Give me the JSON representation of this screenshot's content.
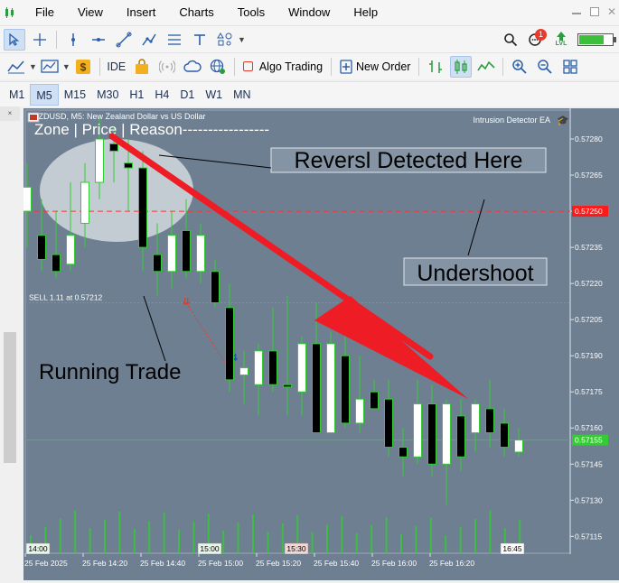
{
  "menu": {
    "items": [
      "File",
      "View",
      "Insert",
      "Charts",
      "Tools",
      "Window",
      "Help"
    ]
  },
  "toolbar2": {
    "ide_label": "IDE",
    "algo_label": "Algo Trading",
    "order_label": "New Order"
  },
  "toolbar1": {
    "notification_count": "1",
    "lvl_label": "LVL"
  },
  "timeframes": [
    "M1",
    "M5",
    "M15",
    "M30",
    "H1",
    "H4",
    "D1",
    "W1",
    "MN"
  ],
  "active_timeframe": "M5",
  "chart": {
    "symbol_title": "NZDUSD, M5:  New Zealand Dollar vs US Dollar",
    "ea_name": "Intrusion Detector EA",
    "header_text": "Zone            |  Price      |  Reason-----------------",
    "annotation_reversal": "Reversl Detected Here",
    "annotation_undershoot": "Undershoot",
    "annotation_running": "Running Trade",
    "trade_label": "SELL 1.11 at 0.57212",
    "red_level_label": "0.57250",
    "current_price_label": "0.57155",
    "colors": {
      "background": "#6d7f91",
      "bull": "#ffffff",
      "bear": "#000000",
      "wick": "#33cc33",
      "arrow": "#ee1c24",
      "red_level": "#ff3333"
    }
  },
  "chart_data": {
    "type": "candlestick",
    "y_ticks": [
      "0.57280",
      "0.57265",
      "0.57250",
      "0.57235",
      "0.57220",
      "0.57205",
      "0.57190",
      "0.57175",
      "0.57160",
      "0.57145",
      "0.57130",
      "0.57115"
    ],
    "ylim": [
      0.57108,
      0.57292
    ],
    "time_labels": [
      "25 Feb 2025",
      "25 Feb 14:20",
      "25 Feb 14:40",
      "25 Feb 15:00",
      "25 Feb 15:20",
      "25 Feb 15:40",
      "25 Feb 16:00",
      "25 Feb 16:20"
    ],
    "session_markers": [
      "14:00",
      "15:00",
      "15:30",
      "16:45"
    ],
    "candles": [
      [
        0.5725,
        0.5727,
        0.57235,
        0.5726
      ],
      [
        0.5724,
        0.57255,
        0.57225,
        0.5723
      ],
      [
        0.57232,
        0.5725,
        0.57222,
        0.57225
      ],
      [
        0.57228,
        0.57262,
        0.57225,
        0.5724
      ],
      [
        0.57245,
        0.5727,
        0.57235,
        0.57262
      ],
      [
        0.57262,
        0.5729,
        0.57255,
        0.5728
      ],
      [
        0.57278,
        0.57285,
        0.57262,
        0.57275
      ],
      [
        0.5727,
        0.5728,
        0.5725,
        0.57268
      ],
      [
        0.57268,
        0.57275,
        0.57225,
        0.57235
      ],
      [
        0.57232,
        0.57245,
        0.57215,
        0.57225
      ],
      [
        0.57225,
        0.5725,
        0.57218,
        0.5724
      ],
      [
        0.57242,
        0.57255,
        0.57222,
        0.57225
      ],
      [
        0.57225,
        0.57245,
        0.5722,
        0.5724
      ],
      [
        0.57225,
        0.5723,
        0.5721,
        0.57212
      ],
      [
        0.5721,
        0.5722,
        0.57175,
        0.5718
      ],
      [
        0.57182,
        0.57192,
        0.5717,
        0.57185
      ],
      [
        0.57178,
        0.57195,
        0.57165,
        0.57192
      ],
      [
        0.57192,
        0.5721,
        0.57175,
        0.57178
      ],
      [
        0.57178,
        0.57215,
        0.57165,
        0.57177
      ],
      [
        0.57175,
        0.57198,
        0.57165,
        0.57195
      ],
      [
        0.57195,
        0.57212,
        0.57158,
        0.57158
      ],
      [
        0.57158,
        0.572,
        0.5716,
        0.57195
      ],
      [
        0.5719,
        0.572,
        0.5716,
        0.57162
      ],
      [
        0.57162,
        0.5719,
        0.57158,
        0.57172
      ],
      [
        0.57175,
        0.5718,
        0.5717,
        0.57168
      ],
      [
        0.57172,
        0.5718,
        0.57148,
        0.57152
      ],
      [
        0.57152,
        0.5716,
        0.5714,
        0.57148
      ],
      [
        0.57148,
        0.5718,
        0.57145,
        0.5717
      ],
      [
        0.5717,
        0.57178,
        0.5714,
        0.57145
      ],
      [
        0.57145,
        0.57172,
        0.57128,
        0.5717
      ],
      [
        0.57165,
        0.57172,
        0.57142,
        0.57148
      ],
      [
        0.57158,
        0.57172,
        0.5715,
        0.5717
      ],
      [
        0.57168,
        0.5718,
        0.57152,
        0.57158
      ],
      [
        0.57162,
        0.57168,
        0.57148,
        0.57152
      ],
      [
        0.5715,
        0.5716,
        0.57148,
        0.57155
      ]
    ],
    "red_level": 0.5725,
    "trade_level": 0.57212,
    "current_price": 0.57155
  }
}
